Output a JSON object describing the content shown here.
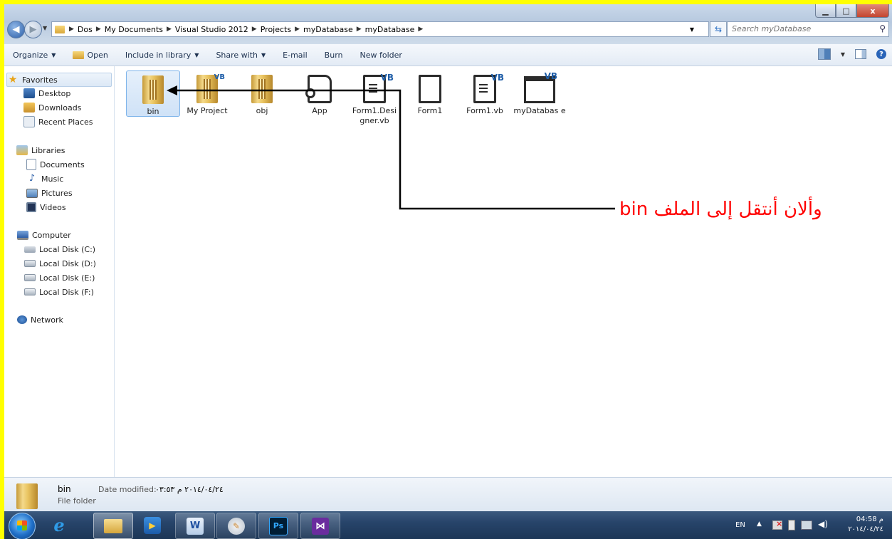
{
  "window": {
    "minimize_glyph": "▁",
    "maximize_glyph": "□",
    "close_glyph": "x"
  },
  "address": {
    "crumbs": [
      "Dos",
      "My Documents",
      "Visual Studio 2012",
      "Projects",
      "myDatabase",
      "myDatabase"
    ],
    "search_placeholder": "Search myDatabase"
  },
  "toolbar": {
    "organize": "Organize",
    "open": "Open",
    "include_in_library": "Include in library",
    "share_with": "Share with",
    "email": "E-mail",
    "burn": "Burn",
    "new_folder": "New folder"
  },
  "sidebar": {
    "favorites": "Favorites",
    "desktop": "Desktop",
    "downloads": "Downloads",
    "recent_places": "Recent Places",
    "libraries": "Libraries",
    "documents": "Documents",
    "music": "Music",
    "pictures": "Pictures",
    "videos": "Videos",
    "computer": "Computer",
    "disk_c": "Local Disk (C:)",
    "disk_d": "Local Disk (D:)",
    "disk_e": "Local Disk (E:)",
    "disk_f": "Local Disk (F:)",
    "network": "Network"
  },
  "files": [
    {
      "name": "bin",
      "icon": "folder-icon",
      "selected": true
    },
    {
      "name": "My Project",
      "icon": "vb-folder-icon"
    },
    {
      "name": "obj",
      "icon": "folder-icon"
    },
    {
      "name": "App",
      "icon": "app-config-icon"
    },
    {
      "name": "Form1.Designer.vb",
      "icon": "vb-document-icon"
    },
    {
      "name": "Form1",
      "icon": "document-icon"
    },
    {
      "name": "Form1.vb",
      "icon": "vb-document-icon"
    },
    {
      "name": "myDatabase",
      "icon": "vb-project-icon"
    }
  ],
  "file_name_display": {
    "form1_designer": "Form1.Desi gner.vb",
    "mydatabase": "myDatabas e"
  },
  "annotation": {
    "text": "وألان أنتقل إلى الملف bin",
    "color": "#ff0000"
  },
  "details": {
    "name": "bin",
    "type": "File folder",
    "date_label": "Date modified:",
    "date_value": "٢٠١٤/٠٤/٢٤ م ٠٣:٥٣"
  },
  "taskbar": {
    "apps": [
      "internet-explorer",
      "windows-explorer",
      "media-player",
      "word",
      "paint",
      "photoshop",
      "visual-studio"
    ],
    "ps_label": "Ps",
    "language": "EN",
    "time": "04:58 م",
    "date": "٢٠١٤/٠٤/٢٤"
  }
}
